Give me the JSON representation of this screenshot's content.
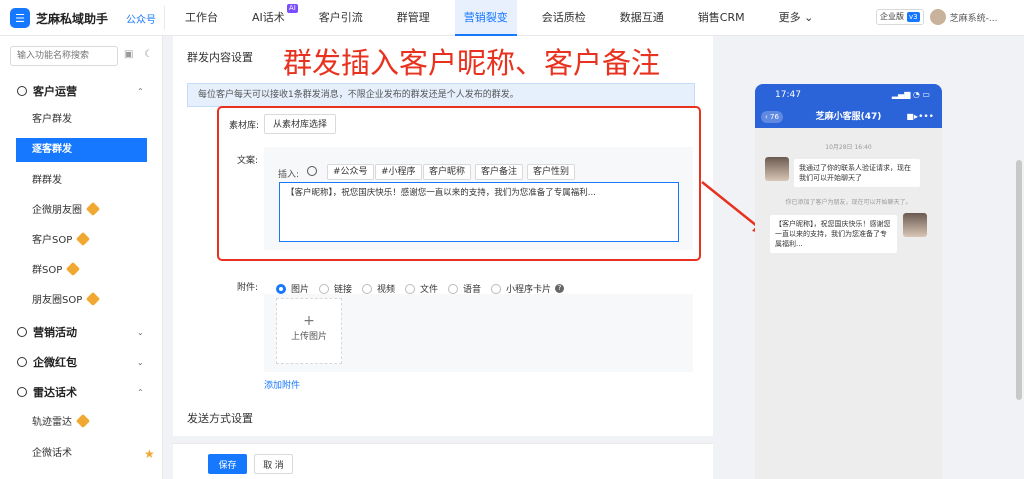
{
  "brand": {
    "name": "芝麻私域助手",
    "sub": "公众号",
    "logo": "chat-logo-icon"
  },
  "nav": [
    {
      "label": "工作台"
    },
    {
      "label": "AI话术",
      "badge": "AI"
    },
    {
      "label": "客户引流"
    },
    {
      "label": "群管理"
    },
    {
      "label": "营销裂变",
      "active": true
    },
    {
      "label": "会话质检"
    },
    {
      "label": "数据互通"
    },
    {
      "label": "销售CRM"
    },
    {
      "label": "更多 ⌄"
    }
  ],
  "top_right": {
    "enterprise": "企业版",
    "version": "v3",
    "user": "芝麻系统-..."
  },
  "sidebar": {
    "search_placeholder": "输入功能名称搜索",
    "groups": [
      {
        "label": "客户运营",
        "caret": "⌃"
      },
      {
        "label": "营销活动",
        "caret": "⌄"
      },
      {
        "label": "企微红包",
        "caret": "⌄"
      },
      {
        "label": "雷达话术",
        "caret": "⌃"
      }
    ],
    "items": [
      {
        "label": "客户群发"
      },
      {
        "label": "逐客群发",
        "active": true
      },
      {
        "label": "群群发"
      },
      {
        "label": "企微朋友圈",
        "vip": true
      },
      {
        "label": "客户SOP",
        "vip": true
      },
      {
        "label": "群SOP",
        "vip": true
      },
      {
        "label": "朋友圈SOP",
        "vip": true
      },
      {
        "label": "轨迹雷达",
        "vip": true
      },
      {
        "label": "企微话术",
        "star": true
      }
    ]
  },
  "main": {
    "section_title": "群发内容设置",
    "notice": "每位客户每天可以接收1条群发消息，不限企业发布的群发还是个人发布的群发。",
    "annotation": "群发插入客户昵称、客户备注",
    "material_label": "素材库:",
    "material_button": "从素材库选择",
    "copy_label": "文案:",
    "insert_label": "插入:",
    "insert_tags": [
      "#公众号",
      "#小程序",
      "客户昵称",
      "客户备注",
      "客户性别"
    ],
    "text_value": "【客户昵称】，祝您国庆快乐！感谢您一直以来的支持，我们为您准备了专属福利...",
    "attach_label": "附件:",
    "attach_types": [
      {
        "label": "图片",
        "selected": true
      },
      {
        "label": "链接"
      },
      {
        "label": "视频"
      },
      {
        "label": "文件"
      },
      {
        "label": "语音"
      },
      {
        "label": "小程序卡片"
      }
    ],
    "upload_plus": "+",
    "upload_label": "上传图片",
    "add_attachment": "添加附件",
    "send_section_title": "发送方式设置"
  },
  "footer": {
    "save": "保存",
    "cancel": "取 消"
  },
  "phone": {
    "time": "17:47",
    "back_count": "76",
    "chat_title": "芝麻小客服(47)",
    "date": "10月28日 16:40",
    "msg1": "我通过了你的联系人验证请求，现在我们可以开始聊天了",
    "system": "你已添加了客户为朋友，现在可以开始聊天了。",
    "msg2": "【客户昵称】，祝您国庆快乐！感谢您一直以来的支持，我们为您准备了专属福利..."
  },
  "colors": {
    "accent": "#1677ff",
    "annotation": "#e8321f",
    "vip": "#f0a830"
  }
}
